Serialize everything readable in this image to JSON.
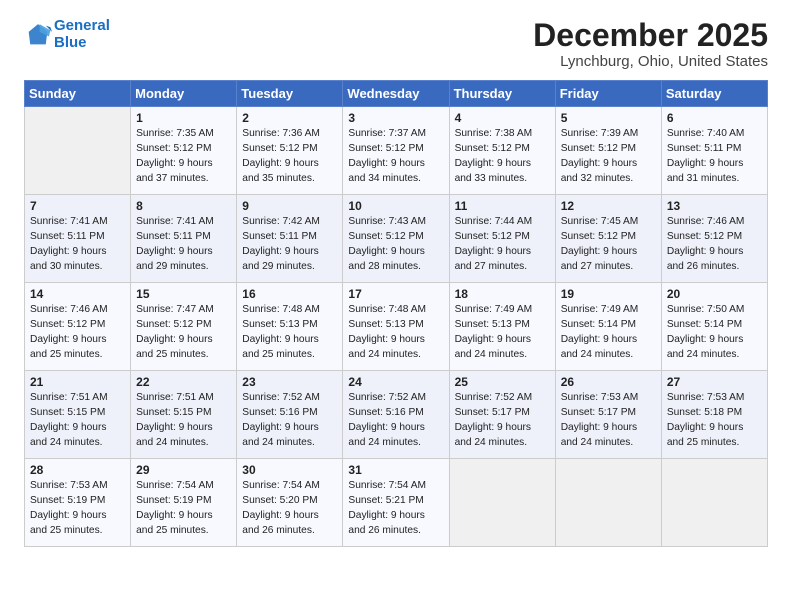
{
  "header": {
    "logo_line1": "General",
    "logo_line2": "Blue",
    "month": "December 2025",
    "location": "Lynchburg, Ohio, United States"
  },
  "weekdays": [
    "Sunday",
    "Monday",
    "Tuesday",
    "Wednesday",
    "Thursday",
    "Friday",
    "Saturday"
  ],
  "weeks": [
    [
      {
        "day": "",
        "sunrise": "",
        "sunset": "",
        "daylight": ""
      },
      {
        "day": "1",
        "sunrise": "Sunrise: 7:35 AM",
        "sunset": "Sunset: 5:12 PM",
        "daylight": "Daylight: 9 hours and 37 minutes."
      },
      {
        "day": "2",
        "sunrise": "Sunrise: 7:36 AM",
        "sunset": "Sunset: 5:12 PM",
        "daylight": "Daylight: 9 hours and 35 minutes."
      },
      {
        "day": "3",
        "sunrise": "Sunrise: 7:37 AM",
        "sunset": "Sunset: 5:12 PM",
        "daylight": "Daylight: 9 hours and 34 minutes."
      },
      {
        "day": "4",
        "sunrise": "Sunrise: 7:38 AM",
        "sunset": "Sunset: 5:12 PM",
        "daylight": "Daylight: 9 hours and 33 minutes."
      },
      {
        "day": "5",
        "sunrise": "Sunrise: 7:39 AM",
        "sunset": "Sunset: 5:12 PM",
        "daylight": "Daylight: 9 hours and 32 minutes."
      },
      {
        "day": "6",
        "sunrise": "Sunrise: 7:40 AM",
        "sunset": "Sunset: 5:11 PM",
        "daylight": "Daylight: 9 hours and 31 minutes."
      }
    ],
    [
      {
        "day": "7",
        "sunrise": "Sunrise: 7:41 AM",
        "sunset": "Sunset: 5:11 PM",
        "daylight": "Daylight: 9 hours and 30 minutes."
      },
      {
        "day": "8",
        "sunrise": "Sunrise: 7:41 AM",
        "sunset": "Sunset: 5:11 PM",
        "daylight": "Daylight: 9 hours and 29 minutes."
      },
      {
        "day": "9",
        "sunrise": "Sunrise: 7:42 AM",
        "sunset": "Sunset: 5:11 PM",
        "daylight": "Daylight: 9 hours and 29 minutes."
      },
      {
        "day": "10",
        "sunrise": "Sunrise: 7:43 AM",
        "sunset": "Sunset: 5:12 PM",
        "daylight": "Daylight: 9 hours and 28 minutes."
      },
      {
        "day": "11",
        "sunrise": "Sunrise: 7:44 AM",
        "sunset": "Sunset: 5:12 PM",
        "daylight": "Daylight: 9 hours and 27 minutes."
      },
      {
        "day": "12",
        "sunrise": "Sunrise: 7:45 AM",
        "sunset": "Sunset: 5:12 PM",
        "daylight": "Daylight: 9 hours and 27 minutes."
      },
      {
        "day": "13",
        "sunrise": "Sunrise: 7:46 AM",
        "sunset": "Sunset: 5:12 PM",
        "daylight": "Daylight: 9 hours and 26 minutes."
      }
    ],
    [
      {
        "day": "14",
        "sunrise": "Sunrise: 7:46 AM",
        "sunset": "Sunset: 5:12 PM",
        "daylight": "Daylight: 9 hours and 25 minutes."
      },
      {
        "day": "15",
        "sunrise": "Sunrise: 7:47 AM",
        "sunset": "Sunset: 5:12 PM",
        "daylight": "Daylight: 9 hours and 25 minutes."
      },
      {
        "day": "16",
        "sunrise": "Sunrise: 7:48 AM",
        "sunset": "Sunset: 5:13 PM",
        "daylight": "Daylight: 9 hours and 25 minutes."
      },
      {
        "day": "17",
        "sunrise": "Sunrise: 7:48 AM",
        "sunset": "Sunset: 5:13 PM",
        "daylight": "Daylight: 9 hours and 24 minutes."
      },
      {
        "day": "18",
        "sunrise": "Sunrise: 7:49 AM",
        "sunset": "Sunset: 5:13 PM",
        "daylight": "Daylight: 9 hours and 24 minutes."
      },
      {
        "day": "19",
        "sunrise": "Sunrise: 7:49 AM",
        "sunset": "Sunset: 5:14 PM",
        "daylight": "Daylight: 9 hours and 24 minutes."
      },
      {
        "day": "20",
        "sunrise": "Sunrise: 7:50 AM",
        "sunset": "Sunset: 5:14 PM",
        "daylight": "Daylight: 9 hours and 24 minutes."
      }
    ],
    [
      {
        "day": "21",
        "sunrise": "Sunrise: 7:51 AM",
        "sunset": "Sunset: 5:15 PM",
        "daylight": "Daylight: 9 hours and 24 minutes."
      },
      {
        "day": "22",
        "sunrise": "Sunrise: 7:51 AM",
        "sunset": "Sunset: 5:15 PM",
        "daylight": "Daylight: 9 hours and 24 minutes."
      },
      {
        "day": "23",
        "sunrise": "Sunrise: 7:52 AM",
        "sunset": "Sunset: 5:16 PM",
        "daylight": "Daylight: 9 hours and 24 minutes."
      },
      {
        "day": "24",
        "sunrise": "Sunrise: 7:52 AM",
        "sunset": "Sunset: 5:16 PM",
        "daylight": "Daylight: 9 hours and 24 minutes."
      },
      {
        "day": "25",
        "sunrise": "Sunrise: 7:52 AM",
        "sunset": "Sunset: 5:17 PM",
        "daylight": "Daylight: 9 hours and 24 minutes."
      },
      {
        "day": "26",
        "sunrise": "Sunrise: 7:53 AM",
        "sunset": "Sunset: 5:17 PM",
        "daylight": "Daylight: 9 hours and 24 minutes."
      },
      {
        "day": "27",
        "sunrise": "Sunrise: 7:53 AM",
        "sunset": "Sunset: 5:18 PM",
        "daylight": "Daylight: 9 hours and 25 minutes."
      }
    ],
    [
      {
        "day": "28",
        "sunrise": "Sunrise: 7:53 AM",
        "sunset": "Sunset: 5:19 PM",
        "daylight": "Daylight: 9 hours and 25 minutes."
      },
      {
        "day": "29",
        "sunrise": "Sunrise: 7:54 AM",
        "sunset": "Sunset: 5:19 PM",
        "daylight": "Daylight: 9 hours and 25 minutes."
      },
      {
        "day": "30",
        "sunrise": "Sunrise: 7:54 AM",
        "sunset": "Sunset: 5:20 PM",
        "daylight": "Daylight: 9 hours and 26 minutes."
      },
      {
        "day": "31",
        "sunrise": "Sunrise: 7:54 AM",
        "sunset": "Sunset: 5:21 PM",
        "daylight": "Daylight: 9 hours and 26 minutes."
      },
      {
        "day": "",
        "sunrise": "",
        "sunset": "",
        "daylight": ""
      },
      {
        "day": "",
        "sunrise": "",
        "sunset": "",
        "daylight": ""
      },
      {
        "day": "",
        "sunrise": "",
        "sunset": "",
        "daylight": ""
      }
    ]
  ]
}
